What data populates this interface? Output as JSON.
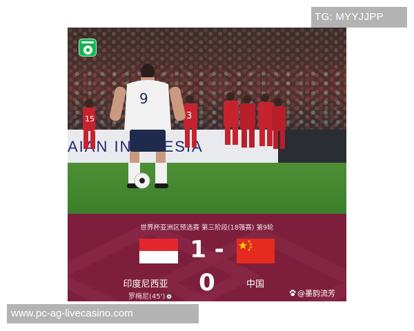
{
  "overlay": {
    "tg_handle": "TG: MYYJJPP",
    "site_url": "www.pc-ag-livecasino.com"
  },
  "photo": {
    "player_number": "9",
    "ad_board_text": "AIAN  IN  ONESIA",
    "shirt_numbers": [
      "15",
      "3"
    ],
    "logo_icon": "football-app-logo-icon"
  },
  "match": {
    "round_title": "世界杯亚洲区预选赛 第三阶段(18强赛) 第9轮",
    "score": "1 - 0",
    "home_team": "印度尼西亚",
    "away_team": "中国",
    "scorer": "罗梅尼(45')",
    "scorer_icon": "football-icon",
    "watermark": "@墨韵流芳",
    "watermark_icon": "paw-icon"
  },
  "colors": {
    "panel": "#7d1f3c",
    "indonesia_red": "#e3262c",
    "china_red": "#e52a1f",
    "china_star": "#ffde00",
    "pitch": "#3f8a2f",
    "badge_gray": "#b3b3b3"
  }
}
